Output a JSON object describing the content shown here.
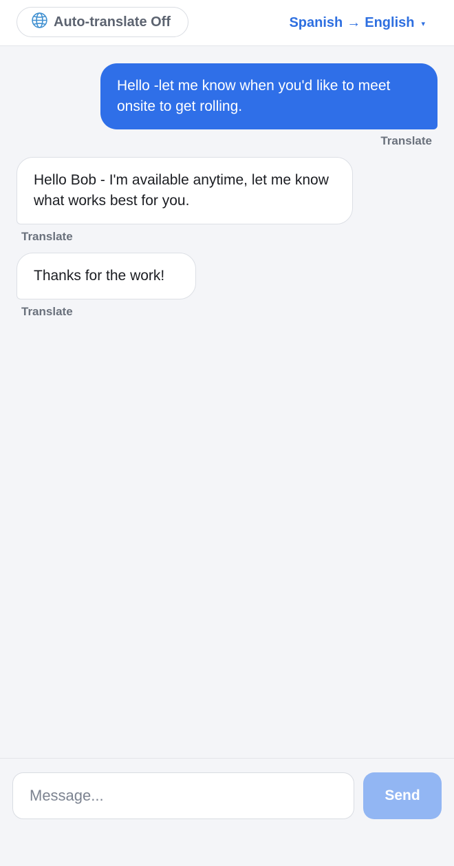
{
  "header": {
    "auto_translate_label": "Auto-translate Off",
    "auto_translate_icon": "globe-icon",
    "language_pair": {
      "from": "Spanish",
      "arrow": "→",
      "to": "English",
      "caret": "▾"
    }
  },
  "messages": [
    {
      "direction": "outgoing",
      "text": "Hello -let me know when you'd like to meet onsite to get rolling.",
      "translate_label": "Translate"
    },
    {
      "direction": "incoming",
      "text": "Hello Bob - I'm available anytime, let me know what works best for you.",
      "translate_label": "Translate"
    },
    {
      "direction": "incoming",
      "text": "Thanks for the work!",
      "translate_label": "Translate"
    }
  ],
  "composer": {
    "value": "",
    "placeholder": "Message...",
    "send_label": "Send"
  },
  "colors": {
    "accent": "#2f6fe8",
    "link": "#2e6fe0",
    "send_disabled": "#92b6f3",
    "background": "#f4f5f8"
  }
}
